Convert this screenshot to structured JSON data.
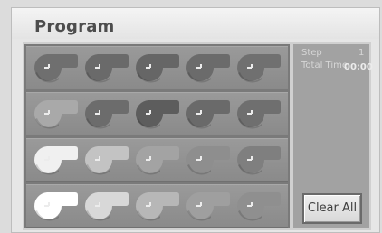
{
  "window": {
    "title": "Program"
  },
  "grid": {
    "rows": [
      {
        "slots": [
          {
            "color": "#6f6f6f"
          },
          {
            "color": "#6a6a6a"
          },
          {
            "color": "#666666"
          },
          {
            "color": "#6b6b6b"
          },
          {
            "color": "#707070"
          }
        ]
      },
      {
        "slots": [
          {
            "color": "#a9a9a9"
          },
          {
            "color": "#6c6c6c"
          },
          {
            "color": "#5d5d5d"
          },
          {
            "color": "#6a6a6a"
          },
          {
            "color": "#6f6f6f"
          }
        ]
      },
      {
        "slots": [
          {
            "color": "#f0f0f0"
          },
          {
            "color": "#c3c3c3"
          },
          {
            "color": "#a3a3a3"
          },
          {
            "color": "#8e8e8e"
          },
          {
            "color": "#7f7f7f"
          }
        ]
      },
      {
        "slots": [
          {
            "color": "#ffffff"
          },
          {
            "color": "#d8d8d8"
          },
          {
            "color": "#b7b7b7"
          },
          {
            "color": "#9f9f9f"
          },
          {
            "color": "#8f8f8f"
          }
        ]
      }
    ]
  },
  "info": {
    "step_label": "Step",
    "step_value": "1",
    "total_time_label": "Total Time",
    "total_time_value": "00:00"
  },
  "actions": {
    "clear_all_label": "Clear All"
  },
  "colors": {
    "panel_dark": "#7a7a7a",
    "panel_info": "#a2a2a2",
    "title_text": "#4d4d4d"
  },
  "icons": {
    "slot_icon": "fan-icon"
  }
}
